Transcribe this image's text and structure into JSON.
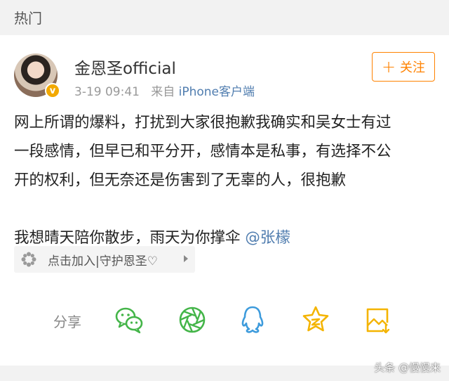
{
  "section": {
    "title": "热门"
  },
  "post": {
    "user_name": "金恩圣official",
    "time": "3-19 09:41",
    "source_prefix": "来自",
    "source": "iPhone客户端",
    "follow_label": "关注",
    "body_lines": [
      "网上所谓的爆料，打扰到大家很抱歉我确实和吴女士有过",
      "一段感情，但早已和平分开，感情本是私事，有选择不公",
      "开的权利，但无奈还是伤害到了无辜的人，很抱歉"
    ],
    "body_last_line": "我想晴天陪你散步，雨天为你撑伞",
    "mention": "@张檬",
    "topic_chip": "点击加入|守护恩圣♡"
  },
  "share": {
    "label": "分享",
    "icons": [
      "wechat-icon",
      "moments-icon",
      "qq-icon",
      "qzone-icon",
      "save-image-icon"
    ]
  },
  "watermark": "头条 @慢慢来",
  "colors": {
    "accent": "#ff8200",
    "link": "#507daf",
    "share_green": "#44b549",
    "share_blue": "#3d9bdc",
    "share_yellow": "#f4b400"
  }
}
